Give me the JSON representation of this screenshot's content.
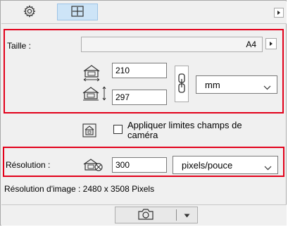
{
  "size_section": {
    "label": "Taille :",
    "preset_value": "A4",
    "width_value": "210",
    "height_value": "297",
    "unit_value": "mm"
  },
  "camera": {
    "checkbox_label_line1": "Appliquer limites champs de",
    "checkbox_label_line2": "caméra",
    "checked": false
  },
  "resolution_section": {
    "label": "Résolution :",
    "value": "300",
    "unit_value": "pixels/pouce"
  },
  "image_resolution_text": "Résolution d'image : 2480 x 3508 Pixels",
  "colors": {
    "highlight_border": "#e2001a",
    "active_tab_bg": "#cde4f7",
    "panel_bg": "#f0f0f0"
  },
  "icons": {
    "tab_settings": "gear-icon",
    "tab_frame": "frame-crosshair-icon",
    "panel_menu": "triangle-right-icon",
    "preset_menu": "triangle-right-icon",
    "width": "width-icon",
    "height": "height-icon",
    "link": "chain-link-icon",
    "camera_limits": "camera-limits-icon",
    "resolution": "resolution-icon",
    "capture": "camera-icon",
    "capture_dropdown": "triangle-down-icon"
  }
}
